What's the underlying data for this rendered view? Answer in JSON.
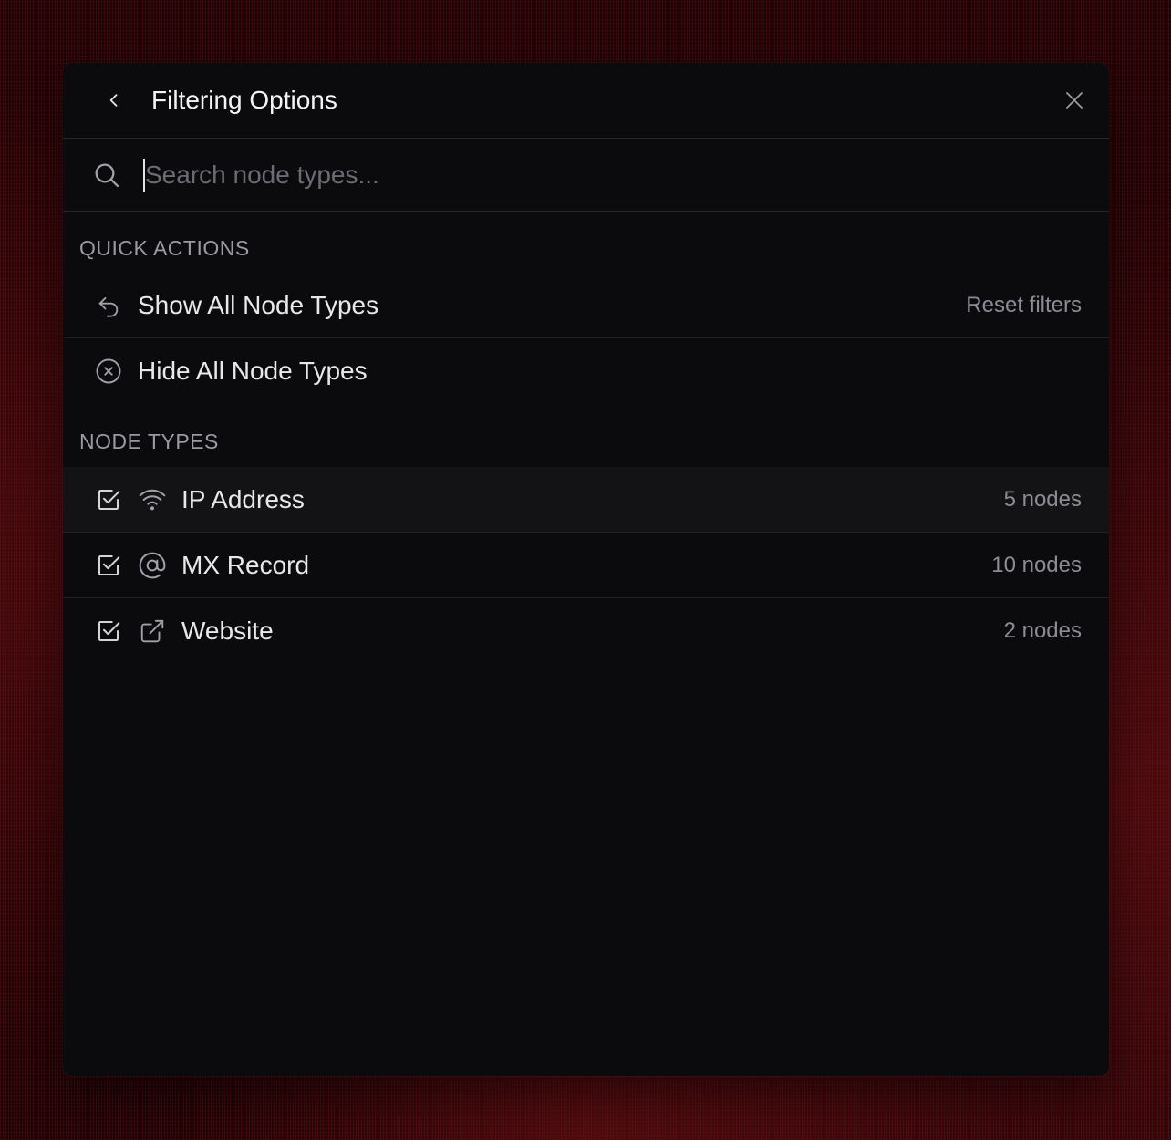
{
  "header": {
    "title": "Filtering Options",
    "back_icon": "chevron-left-icon",
    "close_icon": "close-icon"
  },
  "search": {
    "placeholder": "Search node types...",
    "value": ""
  },
  "quick_actions": {
    "section_label": "QUICK ACTIONS",
    "items": [
      {
        "label": "Show All Node Types",
        "hint": "Reset filters",
        "icon": "undo-icon"
      },
      {
        "label": "Hide All Node Types",
        "icon": "circle-x-icon"
      }
    ]
  },
  "node_types": {
    "section_label": "NODE TYPES",
    "items": [
      {
        "label": "IP Address",
        "count": "5 nodes",
        "checked": true,
        "icon": "wifi-icon"
      },
      {
        "label": "MX Record",
        "count": "10 nodes",
        "checked": true,
        "icon": "at-sign-icon"
      },
      {
        "label": "Website",
        "count": "2 nodes",
        "checked": true,
        "icon": "external-link-icon"
      }
    ]
  },
  "colors": {
    "panel_background": "#0b0b0e",
    "page_background": "#1c0305",
    "text_primary": "#e8e8ea",
    "text_muted": "#8c8c94"
  }
}
